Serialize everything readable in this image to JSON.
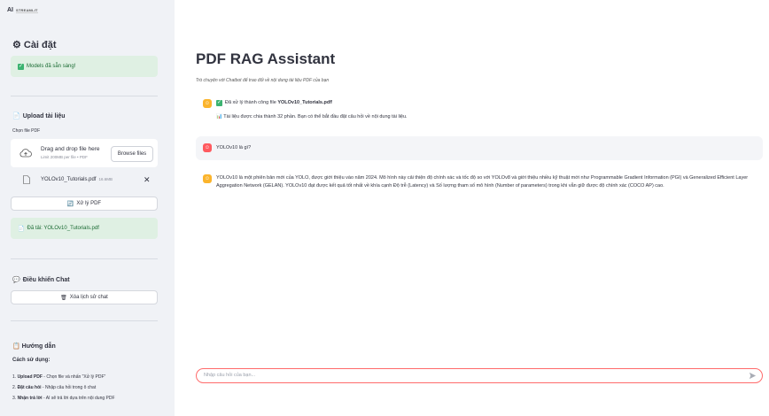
{
  "sidebar": {
    "logo_mark": "AI",
    "logo_text": "STREAMLIT",
    "settings_title": "Cài đặt",
    "models_ready": "Models đã sẵn sàng!",
    "upload_title": "Upload tài liệu",
    "choose_file_label": "Chọn file PDF",
    "dropzone_main": "Drag and drop file here",
    "dropzone_limit": "Limit 200MB per file • PDF",
    "browse_button": "Browse files",
    "file_name": "YOLOv10_Tutorials.pdf",
    "file_size": "16.6MB",
    "process_button": "Xử lý PDF",
    "loaded_info": "Đã tải: YOLOv10_Tutorials.pdf",
    "chat_controls_title": "Điều khiển Chat",
    "clear_button": "Xóa lịch sử chat",
    "guide_title": "Hướng dẫn",
    "guide_subtitle": "Cách sử dụng:",
    "guide_steps": [
      {
        "num": "1.",
        "bold": "Upload PDF",
        "rest": " - Chọn file và nhấn \"Xử lý PDF\""
      },
      {
        "num": "2.",
        "bold": "Đặt câu hỏi",
        "rest": " - Nhập câu hỏi trong ô chat"
      },
      {
        "num": "3.",
        "bold": "Nhận trả lời",
        "rest": " - AI sẽ trả lời dựa trên nội dung PDF"
      }
    ]
  },
  "main": {
    "title": "PDF RAG Assistant",
    "subtitle": "Trò chuyện với Chatbot để trao đổi về nội dung tài liệu PDF của bạn",
    "messages": [
      {
        "role": "assistant",
        "line1_pre": "Đã xử lý thành công file ",
        "line1_bold": "YOLOv10_Tutorials.pdf",
        "line1_post": "!",
        "line2": "Tài liệu được chia thành 32 phần. Bạn có thể bắt đầu đặt câu hỏi về nội dung tài liệu."
      },
      {
        "role": "user",
        "text": "YOLOv10 là gì?"
      },
      {
        "role": "assistant",
        "text": "YOLOv10 là một phiên bản mới của YOLO, được giới thiệu vào năm 2024. Mô hình này cải thiện độ chính xác và tốc độ so với YOLOv8 và giới thiệu nhiều kỹ thuật mới như Programmable Gradient Information (PGI) và Generalized Efficient Layer Aggregation Network (GELAN). YOLOv10 đạt được kết quả tốt nhất về khía cạnh Độ trễ (Latency) và Số lượng tham số mô hình (Number of parameters) trong khi vẫn giữ được độ chính xác (COCO AP) cao."
      }
    ],
    "chat_placeholder": "Nhập câu hỏi của bạn..."
  },
  "colors": {
    "sidebar_bg": "#f0f2f6",
    "success_bg": "#dff0e3",
    "bot_avatar": "#fbb42c",
    "user_avatar": "#ff5a5f",
    "input_border": "#ff6b6b"
  }
}
